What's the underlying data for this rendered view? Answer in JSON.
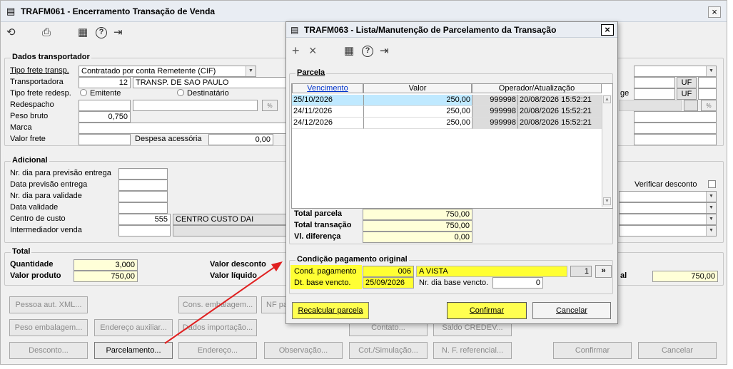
{
  "main": {
    "title": "TRAFM061 - Encerramento Transação de Venda",
    "close": "×",
    "toolbar": {
      "undo": "⟲",
      "print": "⎙",
      "calendar": "▦",
      "help": "?",
      "exit": "⇥"
    },
    "dados": {
      "legend": "Dados transportador",
      "tipo_frete_label": "Tipo frete transp.",
      "tipo_frete_value": "Contratado por conta Remetente (CIF)",
      "transportadora_label": "Transportadora",
      "transportadora_code": "12",
      "transportadora_name": "TRANSP. DE SAO PAULO",
      "tipo_redesp_label": "Tipo frete redesp.",
      "opt_emitente": "Emitente",
      "opt_destinatario": "Destinatário",
      "redespacho_label": "Redespacho",
      "peso_bruto_label": "Peso bruto",
      "peso_bruto_value": "0,750",
      "marca_label": "Marca",
      "valor_frete_label": "Valor frete",
      "despesa_label": "Despesa acessória",
      "despesa_value": "0,00",
      "uf1": "UF",
      "uf2": "UF",
      "ge_frag": "ge"
    },
    "adicional": {
      "legend": "Adicional",
      "nr_dia_prev_label": "Nr. dia para previsão entrega",
      "data_prev_label": "Data previsão entrega",
      "nr_dia_valid_label": "Nr. dia para validade",
      "data_valid_label": "Data validade",
      "centro_label": "Centro de custo",
      "centro_code": "555",
      "centro_name": "CENTRO CUSTO DAI",
      "intermediador_label": "Intermediador venda",
      "verificar_label": "Verificar desconto"
    },
    "total": {
      "legend": "Total",
      "quantidade_label": "Quantidade",
      "quantidade_value": "3,000",
      "valor_produto_label": "Valor produto",
      "valor_produto_value": "750,00",
      "valor_desconto_label": "Valor desconto",
      "valor_liquido_label": "Valor líquido",
      "al_frag": "al",
      "right_value": "750,00"
    },
    "buttons": {
      "pessoa_xml": "Pessoa aut. XML...",
      "cons_emb": "Cons. embalagem...",
      "nf_frag": "NF pa",
      "peso_emb": "Peso embalagem...",
      "end_aux": "Endereço auxiliar...",
      "dados_imp": "Dados importação...",
      "contato": "Contato...",
      "saldo": "Saldo CREDEV...",
      "desconto": "Desconto...",
      "parcelamento": "Parcelamento...",
      "endereco": "Endereço...",
      "observacao": "Observação...",
      "cot_sim": "Cot./Simulação...",
      "nf_ref": "N. F. referencial...",
      "confirmar": "Confirmar",
      "cancelar": "Cancelar"
    }
  },
  "modal": {
    "title": "TRAFM063 - Lista/Manutenção de Parcelamento da Transação",
    "close": "×",
    "toolbar": {
      "add": "+",
      "del": "×",
      "calendar": "▦",
      "help": "?",
      "exit": "⇥"
    },
    "parcela": {
      "legend": "Parcela",
      "headers": [
        "Vencimento",
        "Valor",
        "Operador/Atualização"
      ],
      "rows": [
        {
          "venc": "25/10/2026",
          "valor": "250,00",
          "op": "999998",
          "dt": "20/08/2026 15:52:21"
        },
        {
          "venc": "24/11/2026",
          "valor": "250,00",
          "op": "999998",
          "dt": "20/08/2026 15:52:21"
        },
        {
          "venc": "24/12/2026",
          "valor": "250,00",
          "op": "999998",
          "dt": "20/08/2026 15:52:21"
        }
      ],
      "total_parcela_label": "Total parcela",
      "total_parcela_value": "750,00",
      "total_transacao_label": "Total transação",
      "total_transacao_value": "750,00",
      "vl_diferenca_label": "Vl. diferença",
      "vl_diferenca_value": "0,00"
    },
    "condicao": {
      "legend": "Condição pagamento original",
      "cond_label": "Cond. pagamento",
      "cond_code": "006",
      "cond_desc": "A VISTA",
      "cond_num": "1",
      "cond_btn": "»",
      "dt_base_label": "Dt. base vencto.",
      "dt_base_value": "25/09/2026",
      "nr_dia_label": "Nr. dia base vencto.",
      "nr_dia_value": "0"
    },
    "btn_recalc": "Recalcular parcela",
    "btn_confirmar": "Confirmar",
    "btn_cancelar": "Cancelar"
  },
  "colors": {
    "highlight_yellow": "#ffff33",
    "field_yellow": "#ffffd8",
    "arrow_red": "#e02020",
    "selected_row": "#bfe9ff"
  }
}
